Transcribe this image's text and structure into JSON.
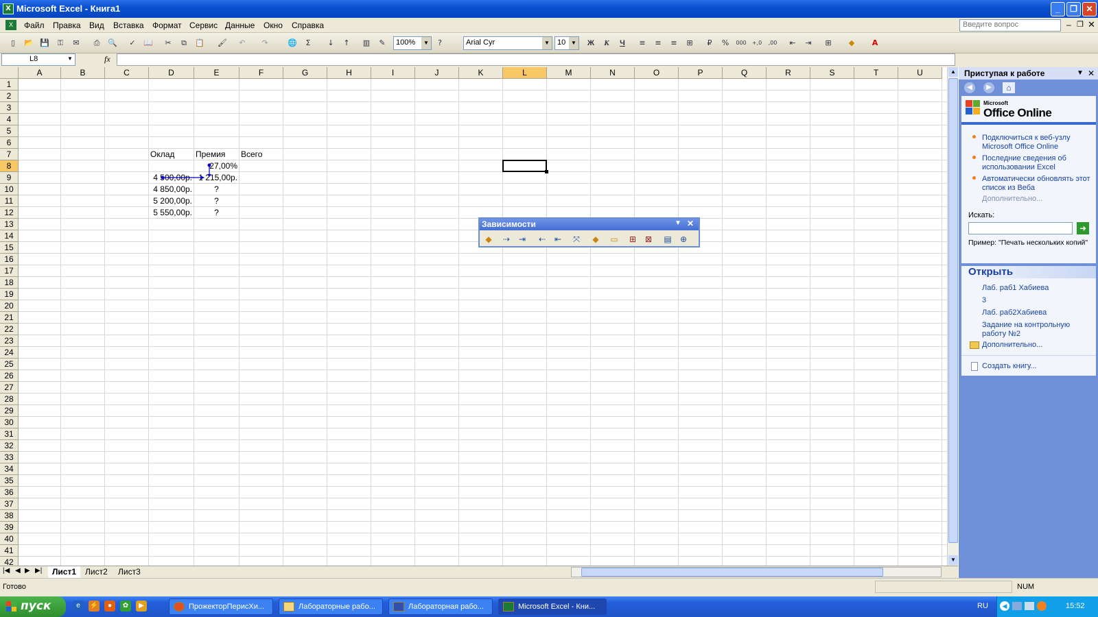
{
  "window": {
    "title": "Microsoft Excel - Книга1"
  },
  "menu": [
    "Файл",
    "Правка",
    "Вид",
    "Вставка",
    "Формат",
    "Сервис",
    "Данные",
    "Окно",
    "Справка"
  ],
  "ask_placeholder": "Введите вопрос",
  "toolbar": {
    "zoom": "100%",
    "font": "Arial Cyr",
    "size": "10",
    "bold": "Ж",
    "italic": "К",
    "underline": "Ч"
  },
  "formula_bar": {
    "name_box": "L8",
    "fx": "fx",
    "content": ""
  },
  "columns": [
    "A",
    "B",
    "C",
    "D",
    "E",
    "F",
    "G",
    "H",
    "I",
    "J",
    "K",
    "L",
    "M",
    "N",
    "O",
    "P",
    "Q",
    "R",
    "S",
    "T",
    "U"
  ],
  "rows": [
    "1",
    "2",
    "3",
    "4",
    "5",
    "6",
    "7",
    "8",
    "9",
    "10",
    "11",
    "12",
    "13",
    "14",
    "15",
    "16",
    "17",
    "18",
    "19",
    "20",
    "21",
    "22",
    "23",
    "24",
    "25",
    "26",
    "27",
    "28",
    "29",
    "30",
    "31",
    "32",
    "33",
    "34",
    "35",
    "36",
    "37",
    "38",
    "39",
    "40",
    "41",
    "42"
  ],
  "cells": {
    "D7": "Оклад",
    "E7": "Премия",
    "F7": "Всего",
    "E8": "27,00%",
    "D9": "4 500,00р.",
    "E9": "1 215,00р.",
    "D10": "4 850,00р.",
    "E10": "?",
    "D11": "5 200,00р.",
    "E11": "?",
    "D12": "5 550,00р.",
    "E12": "?"
  },
  "sheets": [
    "Лист1",
    "Лист2",
    "Лист3"
  ],
  "deps_toolbar": {
    "title": "Зависимости"
  },
  "task_pane": {
    "title": "Приступая к работе",
    "brand_small": "Microsoft",
    "brand": "Office Online",
    "links": [
      "Подключиться к веб-узлу Microsoft Office Online",
      "Последние сведения об использовании Excel",
      "Автоматически обновлять этот список из Веба"
    ],
    "more": "Дополнительно...",
    "search_label": "Искать:",
    "example": "Пример: \"Печать нескольких копий\"",
    "open_title": "Открыть",
    "files": [
      "Лаб. раб1 Хабиева",
      "3",
      "Лаб. раб2Хабиева",
      "Задание на контрольную работу №2"
    ],
    "open_more": "Дополнительно...",
    "create": "Создать книгу..."
  },
  "status": {
    "ready": "Готово",
    "num": "NUM"
  },
  "taskbar": {
    "start": "пуск",
    "buttons": [
      "ПрожекторПерисХи...",
      "Лабораторные рабо...",
      "Лабораторная рабо...",
      "Microsoft Excel - Кни..."
    ],
    "lang": "RU",
    "time": "15:52"
  }
}
